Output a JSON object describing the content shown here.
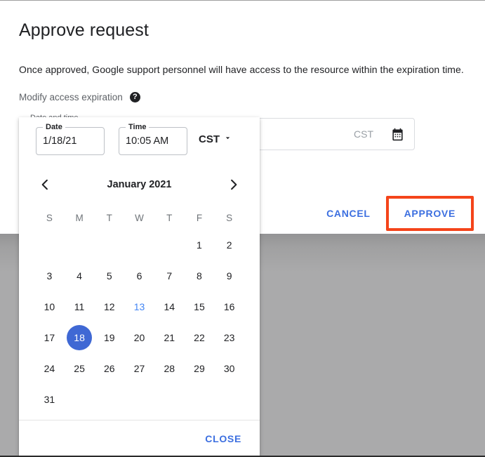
{
  "dialog": {
    "title": "Approve request",
    "body_text": "Once approved, Google support personnel will have access to the resource within the expiration time.",
    "modify_label": "Modify access expiration",
    "help_icon_glyph": "?",
    "cancel_label": "CANCEL",
    "approve_label": "APPROVE"
  },
  "datetime_field": {
    "legend": "Date and time",
    "timezone_display": "CST",
    "calendar_icon": "calendar-icon"
  },
  "picker": {
    "date_label": "Date",
    "date_value": "1/18/21",
    "time_label": "Time",
    "time_value": "10:05 AM",
    "timezone_value": "CST",
    "timezone_caret": "chevron-down-icon",
    "prev_icon": "chevron-left-icon",
    "next_icon": "chevron-right-icon",
    "month_title": "January 2021",
    "weekdays": [
      "S",
      "M",
      "T",
      "W",
      "T",
      "F",
      "S"
    ],
    "weeks": [
      [
        "",
        "",
        "",
        "",
        "",
        "1",
        "2"
      ],
      [
        "3",
        "4",
        "5",
        "6",
        "7",
        "8",
        "9"
      ],
      [
        "10",
        "11",
        "12",
        "13",
        "14",
        "15",
        "16"
      ],
      [
        "17",
        "18",
        "19",
        "20",
        "21",
        "22",
        "23"
      ],
      [
        "24",
        "25",
        "26",
        "27",
        "28",
        "29",
        "30"
      ],
      [
        "31",
        "",
        "",
        "",
        "",
        "",
        ""
      ]
    ],
    "today": "13",
    "selected": "18",
    "close_label": "CLOSE"
  },
  "colors": {
    "accent_blue": "#3c6fe0",
    "selected_blue": "#3f68d4",
    "today_blue": "#4285f4",
    "highlight_red": "#f4441a",
    "backdrop_gray": "#aaaaab",
    "text_primary": "#202124",
    "text_secondary": "#5f6368"
  }
}
